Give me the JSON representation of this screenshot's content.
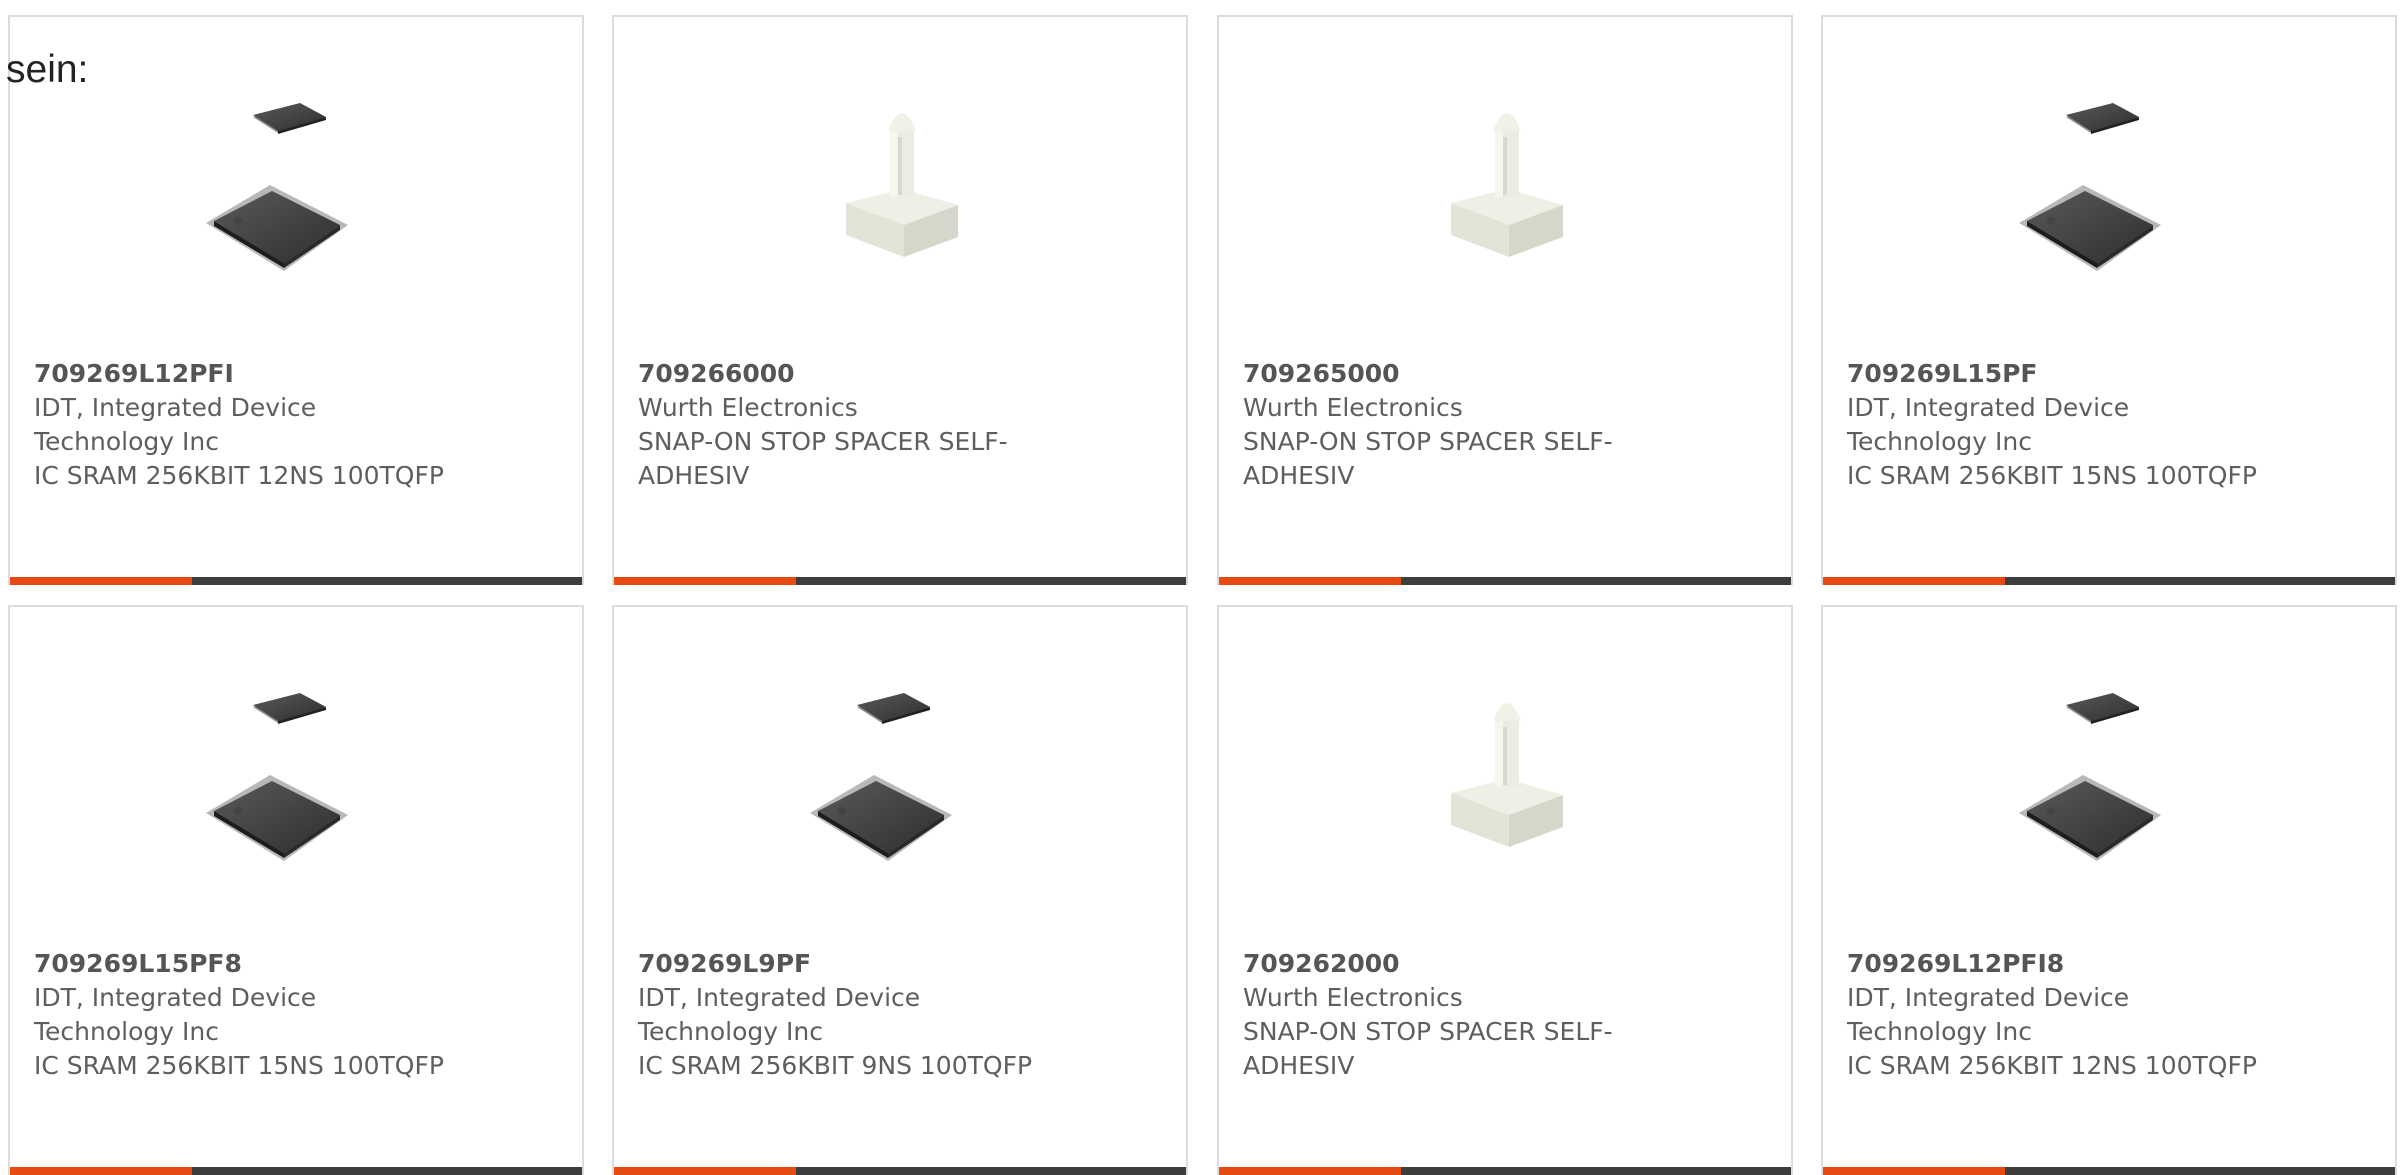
{
  "lead_text": "sein:",
  "colors": {
    "accent": "#e84a14",
    "bar": "#3d3d3d",
    "border": "#dcdcdc",
    "text": "#5e5e5e"
  },
  "products": [
    {
      "part_number": "709269L12PFI",
      "manufacturer_line1": "IDT, Integrated Device",
      "manufacturer_line2": "Technology Inc",
      "description_line1": "IC SRAM 256KBIT 12NS 100TQFP",
      "description_line2": "",
      "image": "ic-chip-image"
    },
    {
      "part_number": "709266000",
      "manufacturer_line1": "Wurth Electronics",
      "manufacturer_line2": "",
      "description_line1": "SNAP-ON STOP SPACER SELF-",
      "description_line2": "ADHESIV",
      "image": "spacer-image"
    },
    {
      "part_number": "709265000",
      "manufacturer_line1": "Wurth Electronics",
      "manufacturer_line2": "",
      "description_line1": "SNAP-ON STOP SPACER SELF-",
      "description_line2": "ADHESIV",
      "image": "spacer-image"
    },
    {
      "part_number": "709269L15PF",
      "manufacturer_line1": "IDT, Integrated Device",
      "manufacturer_line2": "Technology Inc",
      "description_line1": "IC SRAM 256KBIT 15NS 100TQFP",
      "description_line2": "",
      "image": "ic-chip-image"
    },
    {
      "part_number": "709269L15PF8",
      "manufacturer_line1": "IDT, Integrated Device",
      "manufacturer_line2": "Technology Inc",
      "description_line1": "IC SRAM 256KBIT 15NS 100TQFP",
      "description_line2": "",
      "image": "ic-chip-image"
    },
    {
      "part_number": "709269L9PF",
      "manufacturer_line1": "IDT, Integrated Device",
      "manufacturer_line2": "Technology Inc",
      "description_line1": "IC SRAM 256KBIT 9NS 100TQFP",
      "description_line2": "",
      "image": "ic-chip-image"
    },
    {
      "part_number": "709262000",
      "manufacturer_line1": "Wurth Electronics",
      "manufacturer_line2": "",
      "description_line1": "SNAP-ON STOP SPACER SELF-",
      "description_line2": "ADHESIV",
      "image": "spacer-image"
    },
    {
      "part_number": "709269L12PFI8",
      "manufacturer_line1": "IDT, Integrated Device",
      "manufacturer_line2": "Technology Inc",
      "description_line1": "IC SRAM 256KBIT 12NS 100TQFP",
      "description_line2": "",
      "image": "ic-chip-image"
    }
  ]
}
